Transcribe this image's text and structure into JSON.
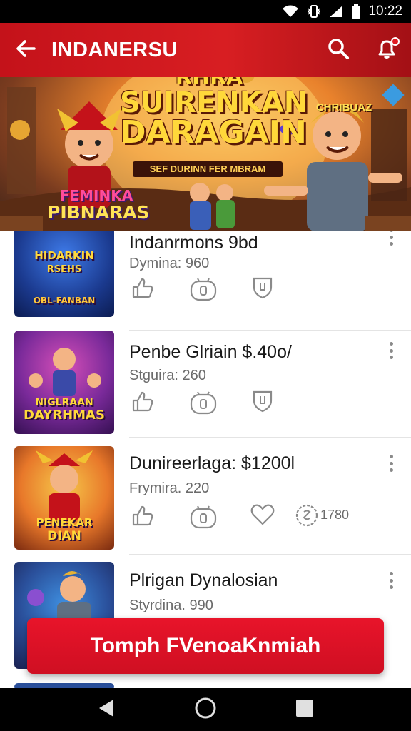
{
  "status_bar": {
    "time": "10:22"
  },
  "app_bar": {
    "title": "INDANERSU",
    "icons": [
      "back-arrow-icon",
      "search-icon",
      "notification-bell-icon"
    ]
  },
  "banner": {
    "headline_1": "RHRA",
    "headline_2": "SUIRENKAN",
    "headline_3": "DARAGAIN",
    "subtitle": "SEF DURINN FER MBRAM",
    "badge_left_1": "FEMINKA",
    "badge_left_2": "PIBNARAS",
    "badge_right": "CHRIBUAZ"
  },
  "items": [
    {
      "name": "Indanrmons 9bd",
      "meta": "Dymina: 960",
      "thumb_text_1": "HIDARKIN",
      "thumb_text_2": "RSEHS",
      "thumb_text_3": "OBL-FANBAN",
      "icons": [
        "thumbs-up-icon",
        "gamepad-icon",
        "shield-icon"
      ]
    },
    {
      "name": "Penbe Glriain $.40o/",
      "meta": "Stguira: 260",
      "thumb_text_1": "NIGLRAAN",
      "thumb_text_2": "DAYRHMAS",
      "icons": [
        "thumbs-up-icon",
        "gamepad-icon",
        "shield-icon"
      ]
    },
    {
      "name": "Dunireerlaga: $1200l",
      "meta": "Frymira. 220",
      "thumb_text_1": "PENEKAR",
      "thumb_text_2": "DIAN",
      "counter": "1780",
      "icons": [
        "thumbs-up-icon",
        "gamepad-icon",
        "heart-icon",
        "coin-icon"
      ]
    },
    {
      "name": "Plrigan Dynalosian",
      "meta": "Styrdina. 990",
      "icons": []
    }
  ],
  "cta": {
    "label": "Tomph FVenoaKnmiah"
  },
  "colors": {
    "brand_red": "#d81e22",
    "cta_red": "#e8142a",
    "text_dark": "#1a1a1a",
    "text_muted": "#6b6b6b"
  }
}
